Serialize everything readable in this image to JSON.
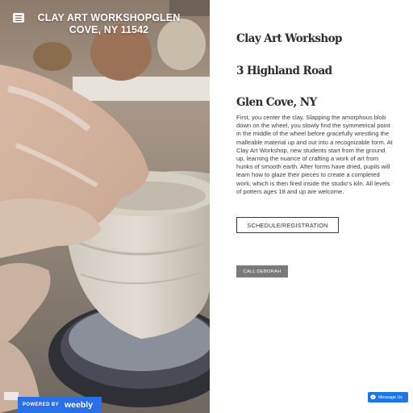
{
  "site": {
    "title": "CLAY ART WORKSHOPGLEN COVE, NY 11542"
  },
  "main": {
    "heading1": "Clay Art Workshop",
    "heading2": "3 Highland Road",
    "heading3": "Glen Cove, NY",
    "description": "First, you center the clay. Slapping the amorphous blob down on the wheel, you slowly find the symmetrical point in the middle of the wheel before gracefully wrestling the malleable material up and out into a recognizable form. At Clay Art Workshop, new students start from the ground up, learning the nuance of crafting a work of art from hunks of smooth earth. After forms have dried, pupils will learn how to glaze their pieces to create a completed work, which is then fired inside the studio's kiln. All levels of potters ages 18 and up are welcome.",
    "schedule_button": "SCHEDULE/REGISTRATION",
    "call_button": "CALL DEBORAH"
  },
  "footer": {
    "powered_by": "POWERED BY",
    "brand": "weebly",
    "messenger_label": "Message Us"
  },
  "colors": {
    "weebly_blue": "#2a6ee8",
    "messenger_blue": "#1f74e8",
    "call_button_gray": "#7a7a7a"
  },
  "icons": [
    "hamburger-menu-icon",
    "messenger-icon"
  ]
}
